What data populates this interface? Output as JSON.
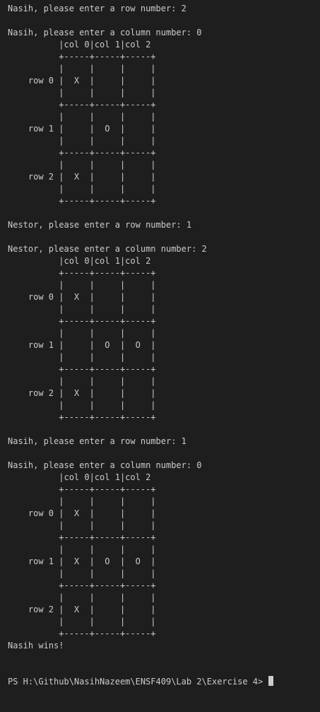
{
  "terminal": {
    "lines": [
      "Nasih, please enter a row number: 2",
      "",
      "Nasih, please enter a column number: 0",
      "          |col 0|col 1|col 2",
      "          +-----+-----+-----+",
      "          |     |     |     |",
      "    row 0 |  X  |     |     |",
      "          |     |     |     |",
      "          +-----+-----+-----+",
      "          |     |     |     |",
      "    row 1 |     |  O  |     |",
      "          |     |     |     |",
      "          +-----+-----+-----+",
      "          |     |     |     |",
      "    row 2 |  X  |     |     |",
      "          |     |     |     |",
      "          +-----+-----+-----+",
      "",
      "Nestor, please enter a row number: 1",
      "",
      "Nestor, please enter a column number: 2",
      "          |col 0|col 1|col 2",
      "          +-----+-----+-----+",
      "          |     |     |     |",
      "    row 0 |  X  |     |     |",
      "          |     |     |     |",
      "          +-----+-----+-----+",
      "          |     |     |     |",
      "    row 1 |     |  O  |  O  |",
      "          |     |     |     |",
      "          +-----+-----+-----+",
      "          |     |     |     |",
      "    row 2 |  X  |     |     |",
      "          |     |     |     |",
      "          +-----+-----+-----+",
      "",
      "Nasih, please enter a row number: 1",
      "",
      "Nasih, please enter a column number: 0",
      "          |col 0|col 1|col 2",
      "          +-----+-----+-----+",
      "          |     |     |     |",
      "    row 0 |  X  |     |     |",
      "          |     |     |     |",
      "          +-----+-----+-----+",
      "          |     |     |     |",
      "    row 1 |  X  |  O  |  O  |",
      "          |     |     |     |",
      "          +-----+-----+-----+",
      "          |     |     |     |",
      "    row 2 |  X  |     |     |",
      "          |     |     |     |",
      "          +-----+-----+-----+",
      "Nasih wins!"
    ],
    "prompt": "PS H:\\Github\\NasihNazeem\\ENSF409\\Lab 2\\Exercise 4> ",
    "colors": {
      "background": "#1e1e1e",
      "text": "#cccccc"
    }
  }
}
